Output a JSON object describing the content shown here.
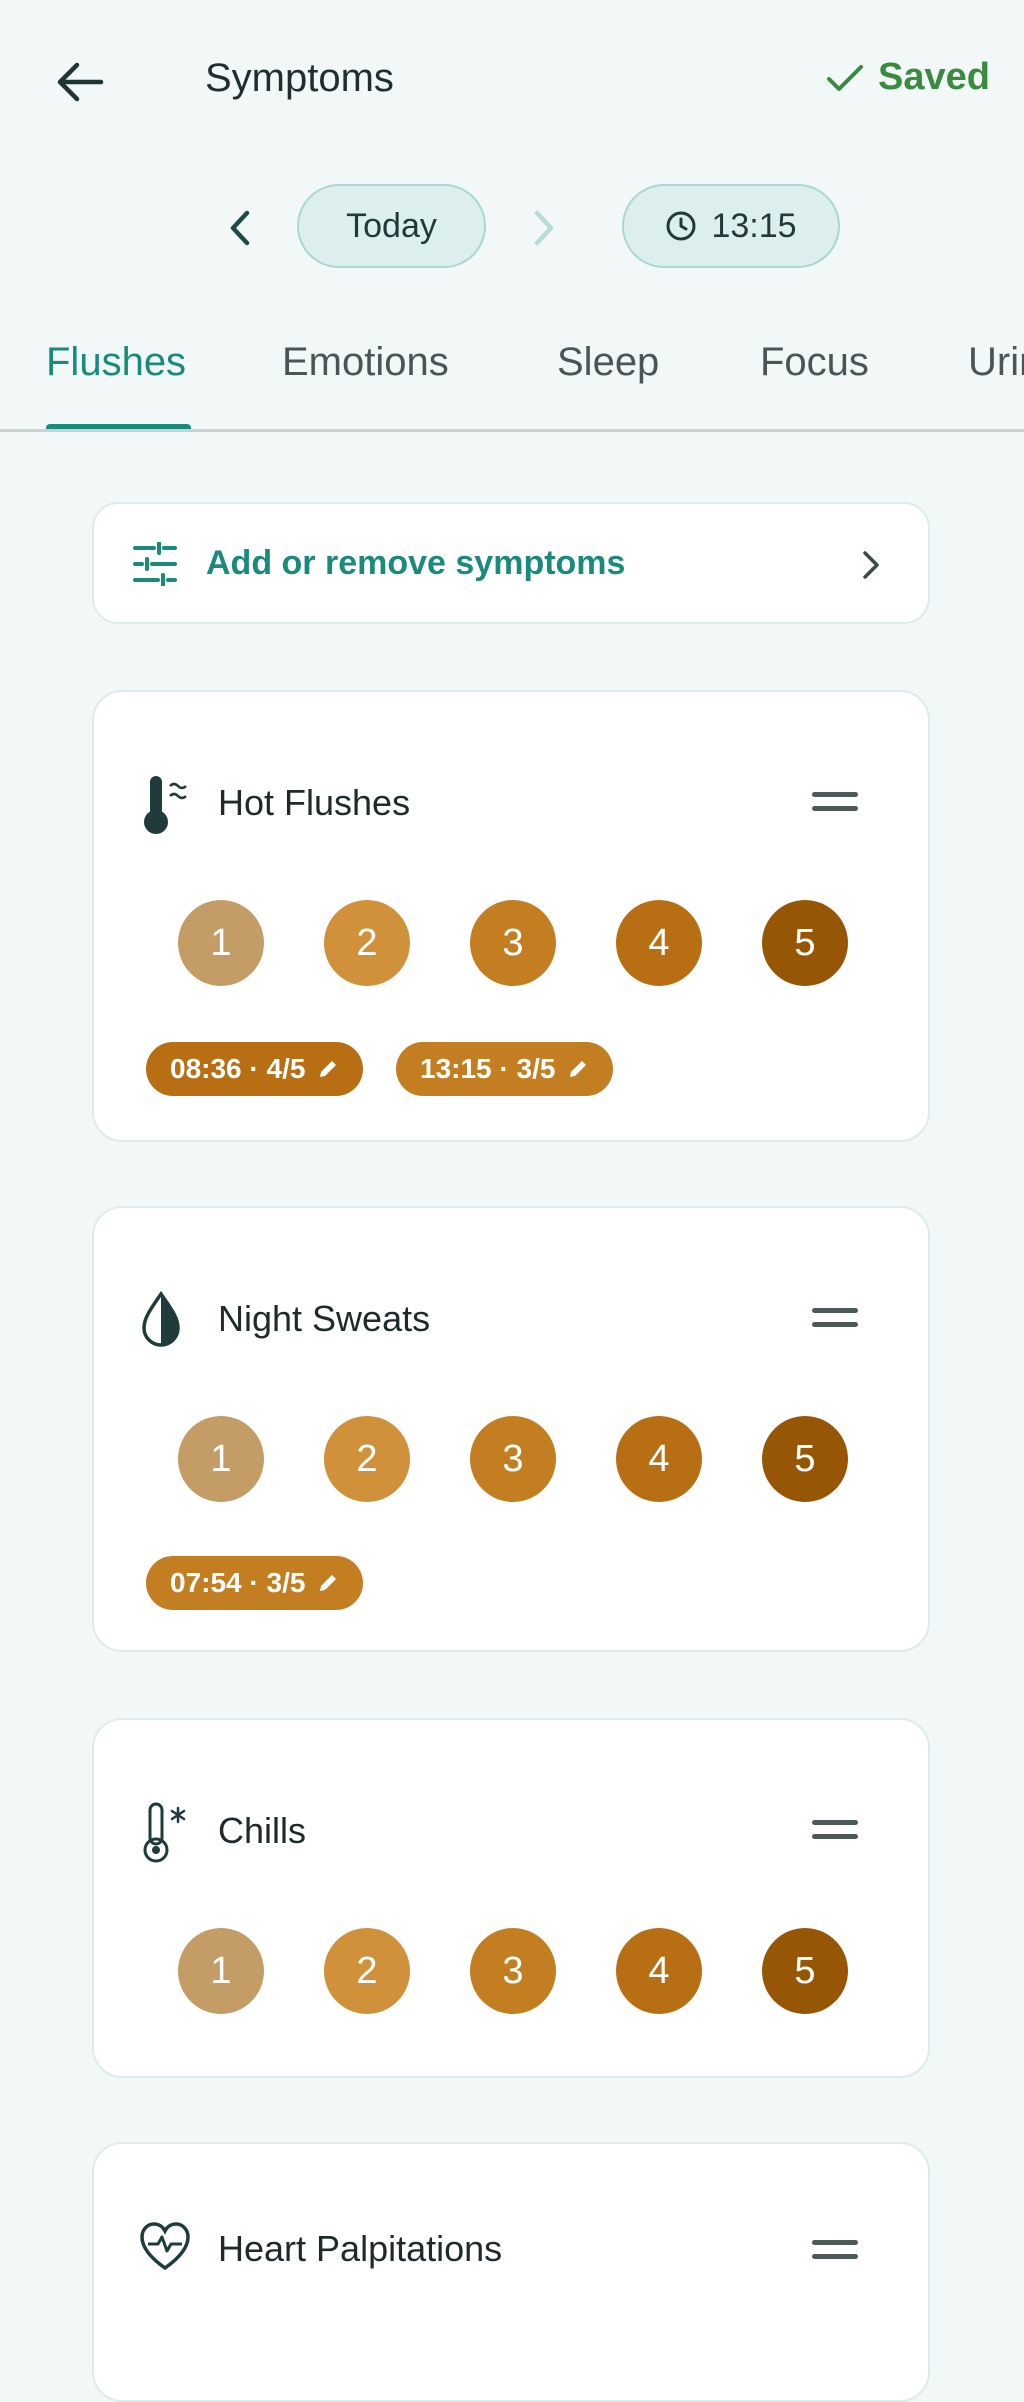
{
  "header": {
    "title": "Symptoms",
    "saved_label": "Saved"
  },
  "date_nav": {
    "date_label": "Today",
    "time_label": "13:15"
  },
  "tabs": [
    {
      "label": "Flushes",
      "active": true
    },
    {
      "label": "Emotions",
      "active": false
    },
    {
      "label": "Sleep",
      "active": false
    },
    {
      "label": "Focus",
      "active": false
    },
    {
      "label": "Urin",
      "active": false
    }
  ],
  "add_symptoms_label": "Add or remove symptoms",
  "severity_colors": [
    "#c49c66",
    "#d1913a",
    "#c47e22",
    "#b86f14",
    "#975606"
  ],
  "accent": "#1a8a7c",
  "saved_color": "#3a8a3f",
  "symptoms": [
    {
      "name": "Hot Flushes",
      "icon": "thermometer-hot-icon",
      "levels": [
        "1",
        "2",
        "3",
        "4",
        "5"
      ],
      "entries": [
        "08:36 · 4/5",
        "13:15 · 3/5"
      ]
    },
    {
      "name": "Night Sweats",
      "icon": "half-drop-icon",
      "levels": [
        "1",
        "2",
        "3",
        "4",
        "5"
      ],
      "entries": [
        "07:54 · 3/5"
      ]
    },
    {
      "name": "Chills",
      "icon": "thermometer-cold-icon",
      "levels": [
        "1",
        "2",
        "3",
        "4",
        "5"
      ],
      "entries": []
    },
    {
      "name": "Heart Palpitations",
      "icon": "heart-pulse-icon",
      "levels": [],
      "entries": []
    }
  ]
}
